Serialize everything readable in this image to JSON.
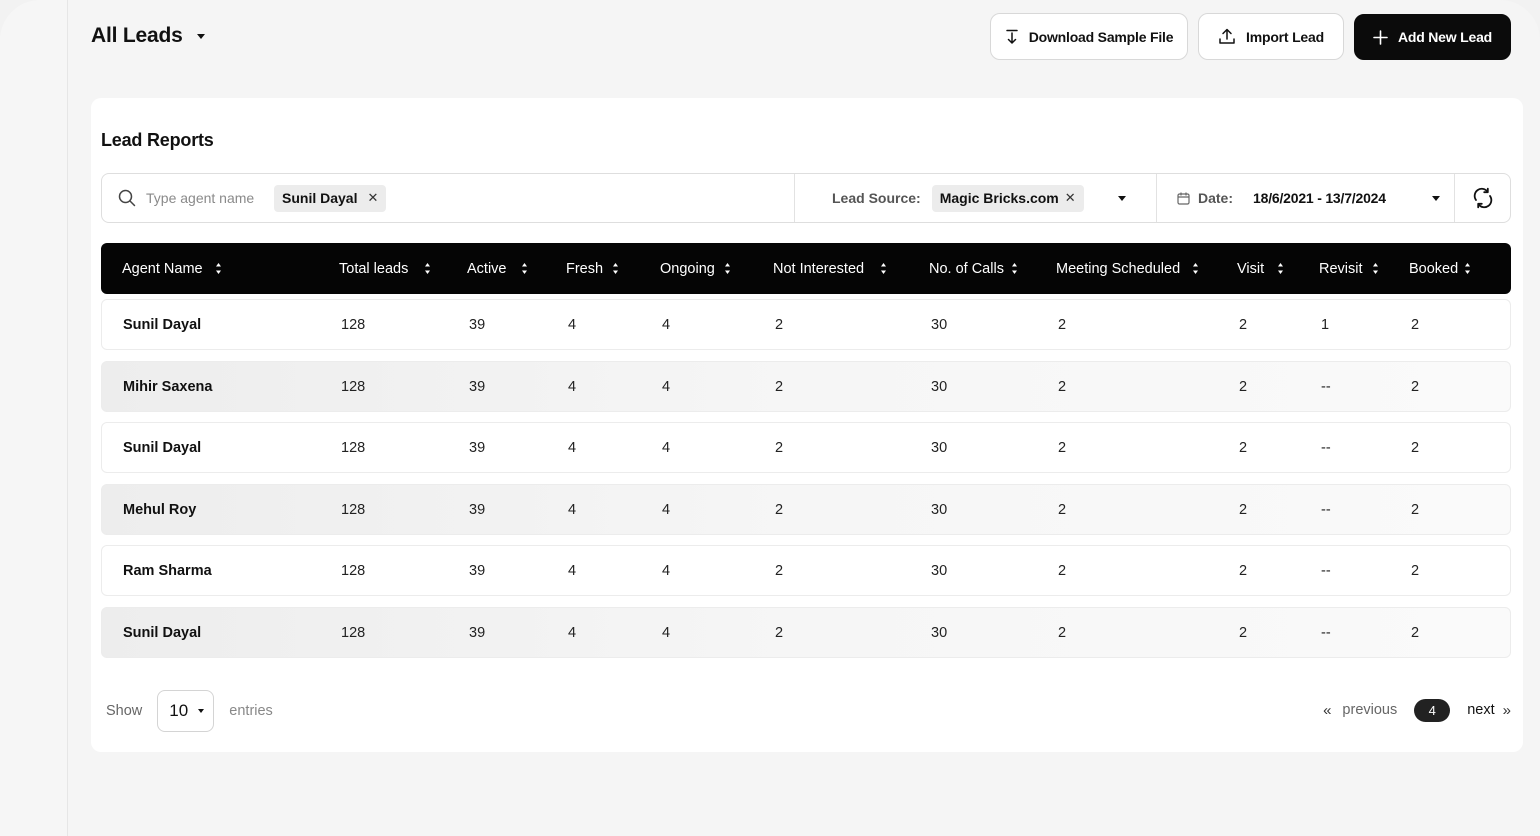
{
  "header": {
    "title": "All Leads",
    "buttons": {
      "download": "Download Sample File",
      "import": "Import Lead",
      "add": "Add New Lead"
    }
  },
  "report": {
    "title": "Lead Reports",
    "filters": {
      "search_placeholder": "Type agent name",
      "agent_chip": "Sunil Dayal",
      "lead_source_label": "Lead Source:",
      "lead_source_chip": "Magic Bricks.com",
      "date_label": "Date:",
      "date_range": "18/6/2021 - 13/7/2024"
    },
    "columns": [
      "Agent Name",
      "Total leads",
      "Active",
      "Fresh",
      "Ongoing",
      "Not Interested",
      "No. of Calls",
      "Meeting Scheduled",
      "Visit",
      "Revisit",
      "Booked"
    ],
    "rows": [
      [
        "Sunil Dayal",
        "128",
        "39",
        "4",
        "4",
        "2",
        "30",
        "2",
        "2",
        "1",
        "2"
      ],
      [
        "Mihir Saxena",
        "128",
        "39",
        "4",
        "4",
        "2",
        "30",
        "2",
        "2",
        "--",
        "2"
      ],
      [
        "Sunil Dayal",
        "128",
        "39",
        "4",
        "4",
        "2",
        "30",
        "2",
        "2",
        "--",
        "2"
      ],
      [
        "Mehul Roy",
        "128",
        "39",
        "4",
        "4",
        "2",
        "30",
        "2",
        "2",
        "--",
        "2"
      ],
      [
        "Ram Sharma",
        "128",
        "39",
        "4",
        "4",
        "2",
        "30",
        "2",
        "2",
        "--",
        "2"
      ],
      [
        "Sunil Dayal",
        "128",
        "39",
        "4",
        "4",
        "2",
        "30",
        "2",
        "2",
        "--",
        "2"
      ]
    ]
  },
  "footer": {
    "show_label": "Show",
    "page_size": "10",
    "entries_label": "entries",
    "previous": "previous",
    "current_page": "4",
    "next": "next"
  },
  "colors": {
    "accent": "#0b0b0b",
    "header_bg": "#050505",
    "page_bg": "#f5f5f5"
  }
}
